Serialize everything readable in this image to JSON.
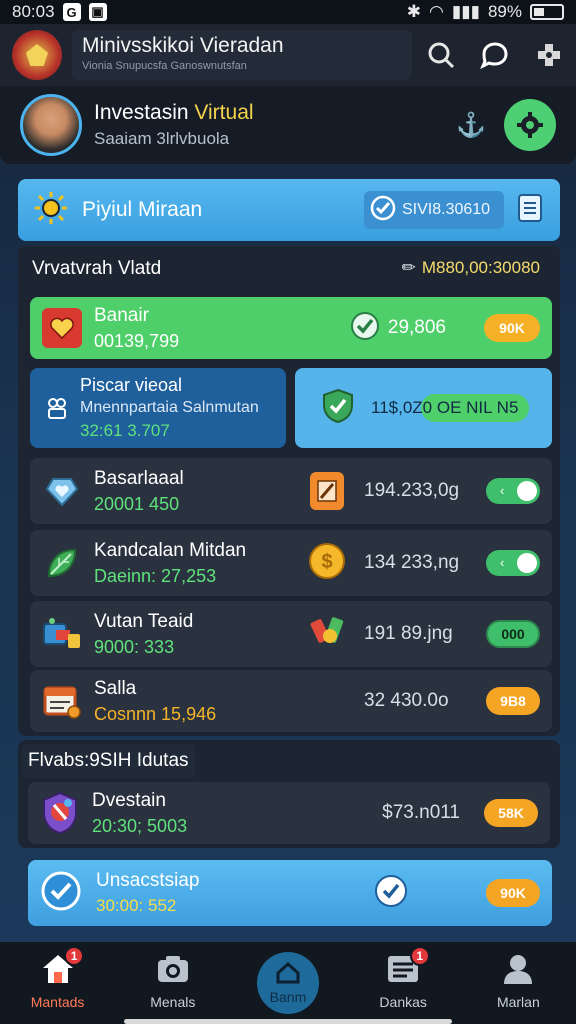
{
  "status_bar": {
    "time": "80:03",
    "icon_g": "G",
    "battery": "89%"
  },
  "app_bar": {
    "title": "Minivsskikoi Vieradan",
    "subtitle": "Vionia Snupucsfa  Ganoswnutsfan"
  },
  "profile": {
    "name_prefix": "Investasin ",
    "name_accent": "Virtual",
    "subtitle": "Saaiam 3lrlvbuola"
  },
  "banner": {
    "title": "Piyiul Miraan",
    "value": "SIVI8.30610"
  },
  "panel": {
    "header": "Vrvatvrah Vlatd",
    "total": "M880,00:30080",
    "rows": [
      {
        "name": "Banair",
        "sub": "00139,799",
        "value": "29,806",
        "pill": "90K"
      },
      {
        "name": "Basarlaaal",
        "sub": "20001 450",
        "value": "194.233,0g"
      },
      {
        "name": "Kandcalan Mitdan",
        "sub": "Daeinn: 27,253",
        "value": "134 233,ng"
      },
      {
        "name": "Vutan Teaid",
        "sub": "9000: 333",
        "value": "191 89.jng",
        "pill": "000"
      },
      {
        "name": "Salla",
        "sub": "Cosnnn 15,946",
        "value": "32 430.0o",
        "pill": "9B8"
      }
    ],
    "split_left": {
      "name": "Piscar vieoal",
      "sub": "Mnennpartaia Salnmutan",
      "value": "32:61 3.707"
    },
    "split_right": {
      "value": "11$,0Z0 OE NIL N5"
    }
  },
  "section2": {
    "title": "Flvabs:9SIH Idutas",
    "row": {
      "name": "Dvestain",
      "sub": "20:30; 5003",
      "value": "$73.n011",
      "pill": "58K"
    }
  },
  "bottom_card": {
    "name": "Unsacstsiap",
    "sub": "30:00: 552",
    "pill": "90K"
  },
  "nav": [
    {
      "label": "Mantads",
      "badge": "1"
    },
    {
      "label": "Menals"
    },
    {
      "label": "Banm"
    },
    {
      "label": "Dankas",
      "badge": "1"
    },
    {
      "label": "Marlan"
    }
  ],
  "colors": {
    "accent_green": "#4ecf73",
    "accent_blue": "#56b8ee",
    "accent_orange": "#f5a524",
    "panel_bg": "#1d2532"
  }
}
